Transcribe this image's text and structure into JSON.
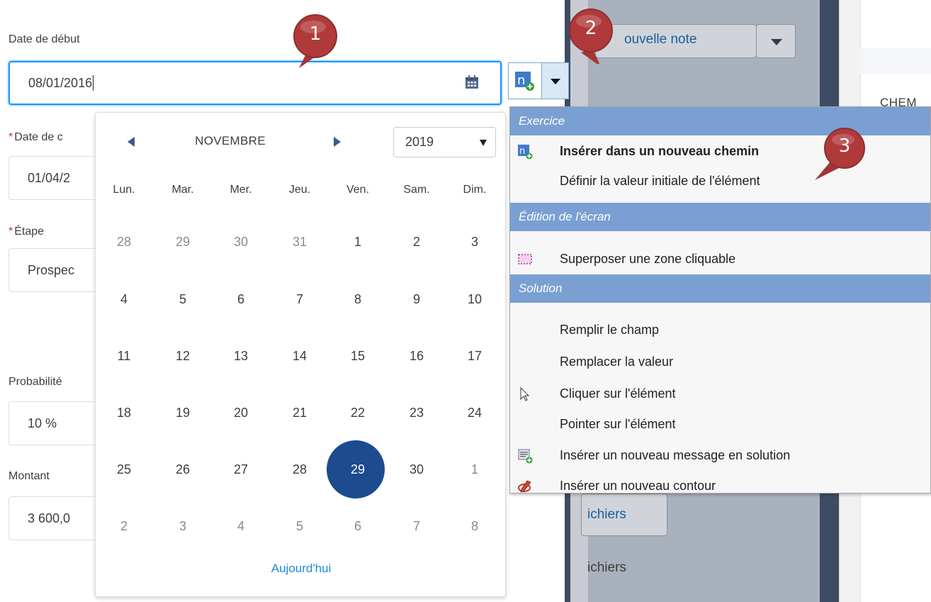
{
  "form": {
    "start_date_label": "Date de début",
    "start_date_value": "08/01/2016",
    "close_date_label": "Date de c",
    "close_date_value": "01/04/2",
    "stage_label": "Étape",
    "stage_value": "Prospec",
    "probability_label": "Probabilité",
    "probability_value": "10 %",
    "amount_label": "Montant",
    "amount_value": "3 600,0",
    "required_mark": "*"
  },
  "datepicker": {
    "month": "NOVEMBRE",
    "year": "2019",
    "weekdays": [
      "Lun.",
      "Mar.",
      "Mer.",
      "Jeu.",
      "Ven.",
      "Sam.",
      "Dim."
    ],
    "weeks": [
      [
        "28",
        "29",
        "30",
        "31",
        "1",
        "2",
        "3"
      ],
      [
        "4",
        "5",
        "6",
        "7",
        "8",
        "9",
        "10"
      ],
      [
        "11",
        "12",
        "13",
        "14",
        "15",
        "16",
        "17"
      ],
      [
        "18",
        "19",
        "20",
        "21",
        "22",
        "23",
        "24"
      ],
      [
        "25",
        "26",
        "27",
        "28",
        "29",
        "30",
        "1"
      ],
      [
        "2",
        "3",
        "4",
        "5",
        "6",
        "7",
        "8"
      ]
    ],
    "selected_day": "29",
    "today_label": "Aujourd'hui"
  },
  "menu": {
    "sections": [
      {
        "title": "Exercice",
        "items": [
          {
            "label": "Insérer dans un nouveau chemin",
            "icon": "new-path-icon",
            "bold": true
          },
          {
            "label": "Définir la valeur initiale de l'élément",
            "icon": "",
            "bold": false
          }
        ]
      },
      {
        "title": "Édition de l'écran",
        "items": [
          {
            "label": "Superposer une zone cliquable",
            "icon": "clickable-zone-icon",
            "bold": false
          }
        ]
      },
      {
        "title": "Solution",
        "items": [
          {
            "label": "Remplir le champ",
            "icon": "",
            "bold": false
          },
          {
            "label": "Remplacer la valeur",
            "icon": "",
            "bold": false
          },
          {
            "label": "Cliquer sur l'élément",
            "icon": "cursor-icon",
            "bold": false
          },
          {
            "label": "Pointer sur l'élément",
            "icon": "",
            "bold": false
          },
          {
            "label": "Insérer un nouveau message en solution",
            "icon": "message-add-icon",
            "bold": false
          },
          {
            "label": "Insérer un nouveau contour",
            "icon": "contour-pen-icon",
            "bold": false
          }
        ]
      }
    ]
  },
  "background": {
    "note_button": "ouvelle note",
    "chem_text": "CHEM",
    "fichiers_button": "ichiers",
    "fichiers_text": "ichiers"
  },
  "badges": [
    "1",
    "2",
    "3"
  ],
  "colors": {
    "accent": "#1b96ff",
    "selected_day": "#1c4b8f",
    "menu_header": "#7a9fd2",
    "badge": "#b03a3a",
    "required": "#c23934"
  }
}
